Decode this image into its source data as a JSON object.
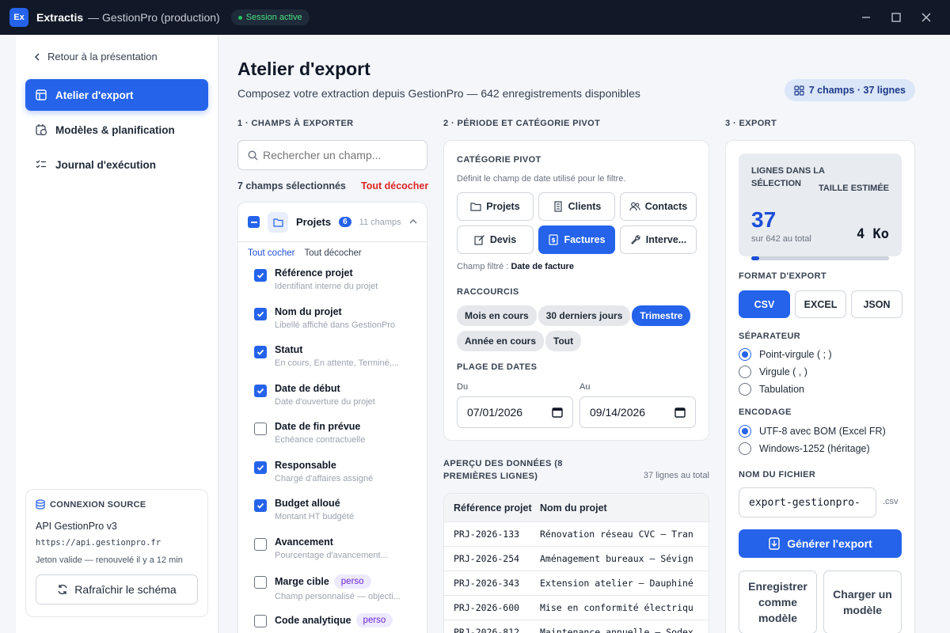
{
  "titlebar": {
    "app_name": "Extractis",
    "app_subtitle": "— GestionPro (production)",
    "logo_text": "Ex",
    "session": "Session active"
  },
  "sidebar": {
    "back_label": "Retour à la présentation",
    "nav": [
      {
        "label": "Atelier d'export",
        "icon": "table-icon",
        "active": true
      },
      {
        "label": "Modèles & planification",
        "icon": "calendar-clock-icon",
        "active": false
      },
      {
        "label": "Journal d'exécution",
        "icon": "checklist-icon",
        "active": false
      }
    ],
    "source": {
      "title": "CONNEXION SOURCE",
      "name": "API GestionPro v3",
      "url": "https://api.gestionpro.fr",
      "token": "Jeton valide — renouvelé il y a 12 min",
      "refresh_label": "Rafraîchir le schéma"
    }
  },
  "header": {
    "title": "Atelier d'export",
    "subtitle": "Composez votre extraction depuis GestionPro — 642 enregistrements disponibles",
    "badge": "7 champs · 37 lignes"
  },
  "fields": {
    "section_title": "1 · CHAMPS À EXPORTER",
    "search_placeholder": "Rechercher un champ...",
    "selected_count": "7 champs sélectionnés",
    "uncheck_all": "Tout décocher",
    "group": {
      "name": "Projets",
      "count": "6",
      "total": "11 champs",
      "check_all": "Tout cocher",
      "uncheck_all": "Tout décocher"
    },
    "items": [
      {
        "label": "Référence projet",
        "desc": "Identifiant interne du projet",
        "checked": true,
        "tag": ""
      },
      {
        "label": "Nom du projet",
        "desc": "Libellé affiché dans GestionPro",
        "checked": true,
        "tag": ""
      },
      {
        "label": "Statut",
        "desc": "En cours, En attente, Terminé,...",
        "checked": true,
        "tag": ""
      },
      {
        "label": "Date de début",
        "desc": "Date d'ouverture du projet",
        "checked": true,
        "tag": ""
      },
      {
        "label": "Date de fin prévue",
        "desc": "Échéance contractuelle",
        "checked": false,
        "tag": ""
      },
      {
        "label": "Responsable",
        "desc": "Chargé d'affaires assigné",
        "checked": true,
        "tag": ""
      },
      {
        "label": "Budget alloué",
        "desc": "Montant HT budgété",
        "checked": true,
        "tag": ""
      },
      {
        "label": "Avancement",
        "desc": "Pourcentage d'avancement...",
        "checked": false,
        "tag": ""
      },
      {
        "label": "Marge cible",
        "desc": "Champ personnalisé — objecti...",
        "checked": false,
        "tag": "perso"
      },
      {
        "label": "Code analytique",
        "desc": "",
        "checked": false,
        "tag": "perso"
      }
    ]
  },
  "pivot": {
    "section_title": "2 · PÉRIODE ET CATÉGORIE PIVOT",
    "title": "CATÉGORIE PIVOT",
    "desc": "Définit le champ de date utilisé pour le filtre.",
    "categories": [
      {
        "label": "Projets",
        "icon": "folder-icon",
        "active": false
      },
      {
        "label": "Clients",
        "icon": "building-icon",
        "active": false
      },
      {
        "label": "Contacts",
        "icon": "users-icon",
        "active": false
      },
      {
        "label": "Devis",
        "icon": "edit-icon",
        "active": false
      },
      {
        "label": "Factures",
        "icon": "invoice-icon",
        "active": true
      },
      {
        "label": "Interve...",
        "icon": "wrench-icon",
        "active": false
      }
    ],
    "filter_prefix": "Champ filtré :",
    "filter_field": "Date de facture",
    "shortcuts_title": "RACCOURCIS",
    "shortcuts": [
      {
        "label": "Mois en cours",
        "active": false
      },
      {
        "label": "30 derniers jours",
        "active": false
      },
      {
        "label": "Trimestre",
        "active": true
      },
      {
        "label": "Année en cours",
        "active": false
      },
      {
        "label": "Tout",
        "active": false
      }
    ],
    "range_title": "PLAGE DE DATES",
    "from_label": "Du",
    "to_label": "Au",
    "from_value": "07/01/2026",
    "to_value": "09/14/2026"
  },
  "preview": {
    "title": "APERÇU DES DONNÉES (8 PREMIÈRES LIGNES)",
    "count": "37 lignes au total",
    "columns": [
      "Référence projet",
      "Nom du projet"
    ],
    "rows": [
      [
        "PRJ-2026-133",
        "Rénovation réseau CVC — Tran"
      ],
      [
        "PRJ-2026-254",
        "Aménagement bureaux — Sévign"
      ],
      [
        "PRJ-2026-343",
        "Extension atelier — Dauphiné"
      ],
      [
        "PRJ-2026-600",
        "Mise en conformité électriqu"
      ],
      [
        "PRJ-2026-812",
        "Maintenance annuelle — Sodex"
      ]
    ]
  },
  "export": {
    "section_title": "3 · EXPORT",
    "rows_label": "LIGNES DANS LA SÉLECTION",
    "rows_value": "37",
    "rows_of": "sur 642 au total",
    "size_label": "TAILLE ESTIMÉE",
    "size_value": "4 Ko",
    "progress_fraction": 0.058,
    "format_title": "FORMAT D'EXPORT",
    "formats": [
      {
        "label": "CSV",
        "active": true
      },
      {
        "label": "EXCEL",
        "active": false
      },
      {
        "label": "JSON",
        "active": false
      }
    ],
    "separator_title": "SÉPARATEUR",
    "separators": [
      {
        "label": "Point-virgule ( ; )",
        "on": true
      },
      {
        "label": "Virgule ( , )",
        "on": false
      },
      {
        "label": "Tabulation",
        "on": false
      }
    ],
    "encoding_title": "ENCODAGE",
    "encodings": [
      {
        "label": "UTF-8 avec BOM (Excel FR)",
        "on": true
      },
      {
        "label": "Windows-1252 (héritage)",
        "on": false
      }
    ],
    "filename_title": "NOM DU FICHIER",
    "filename": "export-gestionpro-",
    "extension": ".csv",
    "generate_label": "Générer l'export",
    "save_model_label": "Enregistrer comme modèle",
    "load_model_label": "Charger un modèle"
  },
  "colors": {
    "accent": "#2563eb",
    "titlebar": "#111827",
    "danger": "#dc2626",
    "tag": "#6d28d9"
  }
}
